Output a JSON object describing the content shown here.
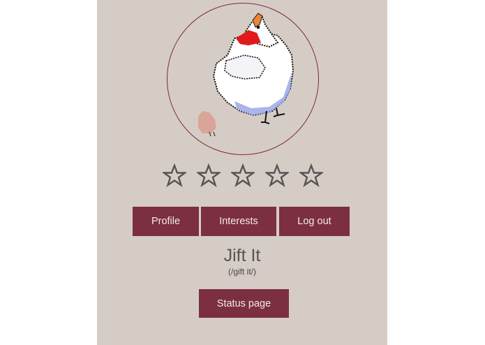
{
  "profile": {
    "avatar_alt": "white chicken with red comb and orange beak",
    "rating": {
      "max": 5,
      "filled": 0
    },
    "name": "Jift It",
    "pronunciation": "(/gift it/)"
  },
  "nav": {
    "profile_label": "Profile",
    "interests_label": "Interests",
    "logout_label": "Log out"
  },
  "actions": {
    "status_label": "Status page"
  },
  "colors": {
    "panel_bg": "#d6ccc6",
    "button_bg": "#7b2f40",
    "button_text": "#f4eaea",
    "avatar_ring": "#7a2a3c",
    "star_stroke": "#555555"
  },
  "icons": {
    "star": "star-outline-icon"
  }
}
